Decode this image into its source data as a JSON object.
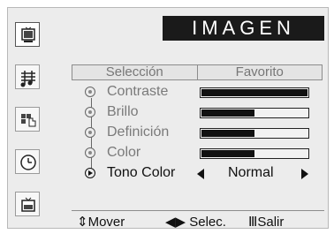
{
  "title": "IMAGEN",
  "tabs": [
    {
      "label": "Selección"
    },
    {
      "label": "Favorito"
    }
  ],
  "settings": [
    {
      "label": "Contraste",
      "level": 1.0
    },
    {
      "label": "Brillo",
      "level": 0.5
    },
    {
      "label": "Definición",
      "level": 0.5
    },
    {
      "label": "Color",
      "level": 0.5
    }
  ],
  "tone": {
    "label": "Tono Color",
    "value": "Normal"
  },
  "help": {
    "move": "Mover",
    "select": "Selec.",
    "exit": "Salir"
  },
  "sidebar_icons": [
    {
      "name": "picture-icon",
      "active": true
    },
    {
      "name": "sound-icon",
      "active": false
    },
    {
      "name": "channel-icon",
      "active": false
    },
    {
      "name": "clock-icon",
      "active": false
    },
    {
      "name": "setup-icon",
      "active": false
    }
  ]
}
